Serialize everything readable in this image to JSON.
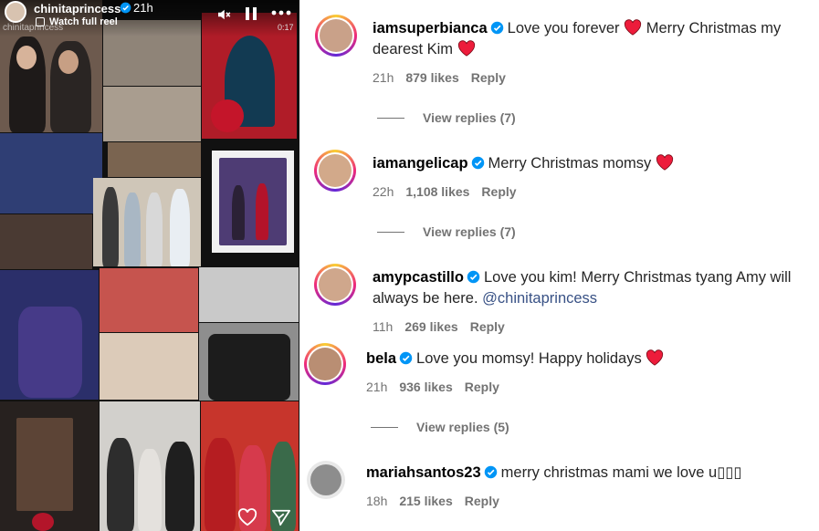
{
  "reel": {
    "username": "chinitaprincess",
    "time": "21h",
    "watch_label": "Watch full reel",
    "timer": "0:17",
    "watermark": "chinitaprincess",
    "icons": [
      "volume-mute-icon",
      "pause-icon",
      "more-icon",
      "heart-icon",
      "send-icon",
      "verified-icon",
      "reel-icon"
    ]
  },
  "comments": [
    {
      "user": "iamsuperbianca",
      "text": "Love you forever ❤️ Merry Christmas my dearest Kim ❤️",
      "time": "21h",
      "likes": "879 likes",
      "reply": "Reply",
      "view_replies": "View replies (7)"
    },
    {
      "user": "iamangelicap",
      "text": "Merry Christmas momsy ❤️",
      "time": "22h",
      "likes": "1,108 likes",
      "reply": "Reply",
      "view_replies": "View replies (7)"
    },
    {
      "user": "amypcastillo",
      "text": "Love you kim! Merry Christmas tyang Amy will always be here. ",
      "mention": "@chinitaprincess",
      "time": "11h",
      "likes": "269 likes",
      "reply": "Reply"
    },
    {
      "user": "bela",
      "text": "Love you momsy! Happy holidays ❤️",
      "time": "21h",
      "likes": "936 likes",
      "reply": "Reply",
      "view_replies": "View replies (5)"
    },
    {
      "user": "mariahsantos23",
      "text": "merry christmas mami we love u▯▯▯",
      "time": "18h",
      "likes": "215 likes",
      "reply": "Reply"
    }
  ],
  "colors": {
    "verified": "#0095f6",
    "heart": "#ed1c3b",
    "text": "#262626",
    "meta": "#737373",
    "mention": "#385185"
  }
}
